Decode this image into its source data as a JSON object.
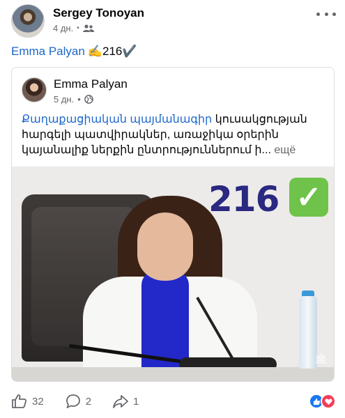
{
  "post": {
    "author": "Sergey Tonoyan",
    "time": "4 дн.",
    "dot": "•",
    "share_mention": "Emma  Palyan",
    "share_rest": "✍️216✔️"
  },
  "shared": {
    "author": "Emma  Palyan",
    "time": "5 дн.",
    "dot": "•",
    "hashtag": "Քաղաքացիական պայմանագիր",
    "text": " կուսակցության հարգելի պատվիրակներ, առաջիկա օրերին կայանալիք ներքին ընտրություններում ի...",
    "more": " ещё",
    "photo_number": "216",
    "photo_check": "✓",
    "watermark": "🏛"
  },
  "footer": {
    "likes": "32",
    "comments": "2",
    "shares": "1"
  },
  "colors": {
    "link": "#1d67c9",
    "muted": "#65676b",
    "like_blue": "#1877f2",
    "love_red": "#f33e58",
    "check_green": "#6fc34a"
  },
  "icons": [
    "group-audience-icon",
    "globe-icon",
    "like-icon",
    "comment-icon",
    "share-icon",
    "more-dots-icon"
  ]
}
